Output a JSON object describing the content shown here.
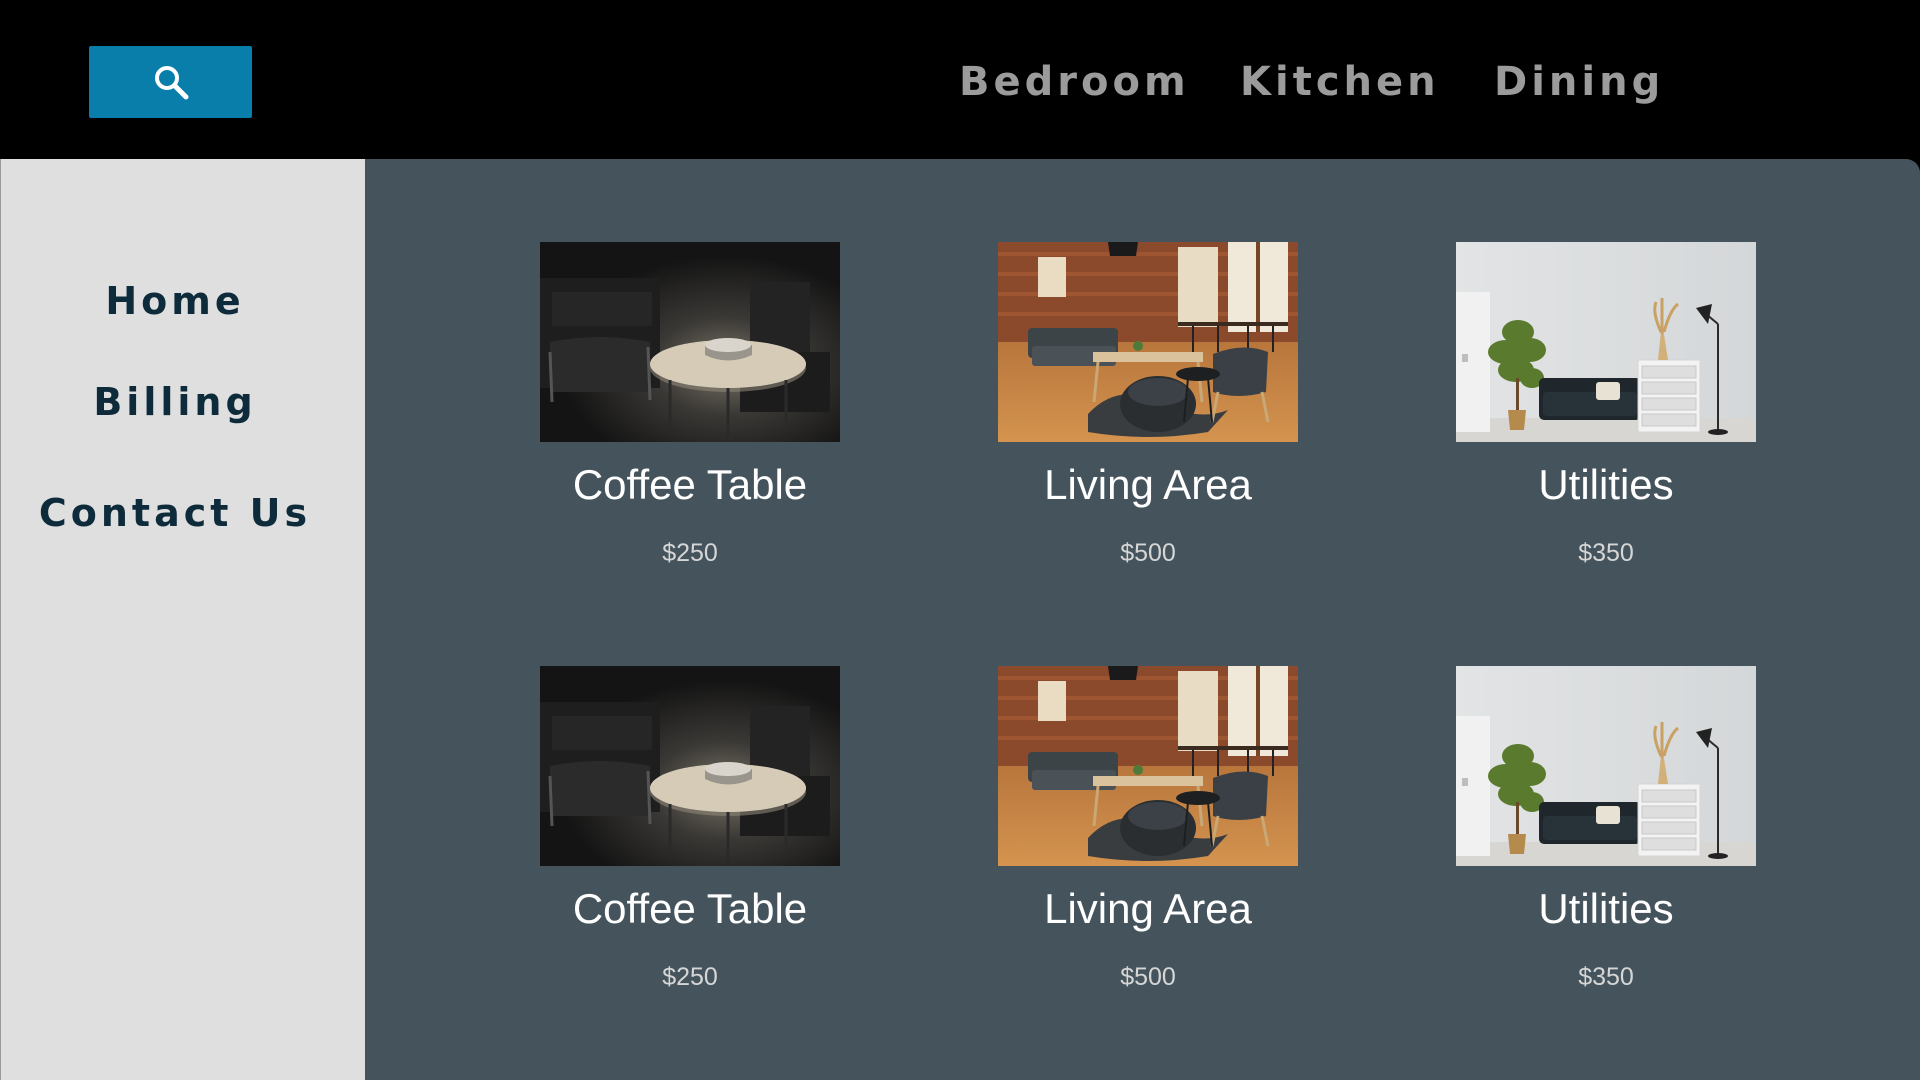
{
  "header": {
    "search_icon": "search-icon",
    "nav": [
      "Bedroom",
      "Kitchen",
      "Dining"
    ],
    "colors": {
      "background": "#000000",
      "search_button": "#0a7eaa",
      "nav_text": "#9b9b9b"
    }
  },
  "sidebar": {
    "items": [
      "Home",
      "Billing",
      "Contact Us"
    ],
    "colors": {
      "background": "#dfdfdf",
      "text": "#0d2b3a"
    }
  },
  "main": {
    "background": "#45545c",
    "products": [
      {
        "name": "Coffee Table",
        "price": "$250",
        "image": "dark-room-coffee-table-photo"
      },
      {
        "name": "Living Area",
        "price": "$500",
        "image": "loft-living-area-photo"
      },
      {
        "name": "Utilities",
        "price": "$350",
        "image": "white-room-sofa-dresser-photo"
      },
      {
        "name": "Coffee Table",
        "price": "$250",
        "image": "dark-room-coffee-table-photo"
      },
      {
        "name": "Living Area",
        "price": "$500",
        "image": "loft-living-area-photo"
      },
      {
        "name": "Utilities",
        "price": "$350",
        "image": "white-room-sofa-dresser-photo"
      }
    ]
  }
}
